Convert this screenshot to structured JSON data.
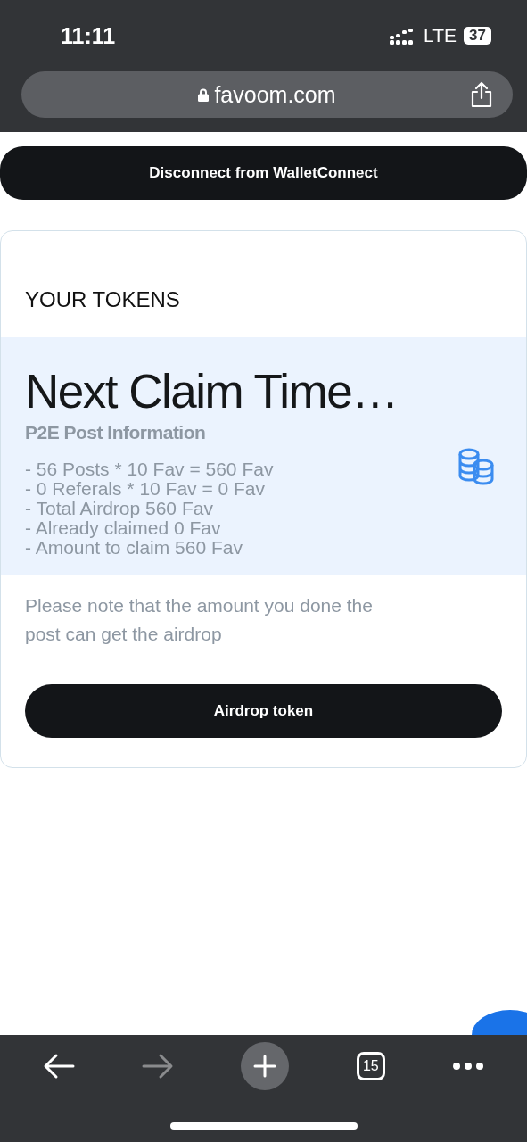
{
  "status_bar": {
    "time": "11:11",
    "network": "LTE",
    "battery": "37"
  },
  "address_bar": {
    "url": "favoom.com"
  },
  "disconnect_button": "Disconnect from WalletConnect",
  "card": {
    "title": "YOUR TOKENS",
    "heading": "Next Claim Time…",
    "subheading": "P2E Post Information",
    "lines": [
      "- 56 Posts * 10 Fav = 560 Fav",
      "- 0 Referals * 10 Fav = 0 Fav",
      "- Total Airdrop 560 Fav",
      "- Already claimed 0 Fav",
      "- Amount to claim 560 Fav"
    ],
    "note": "Please note that the amount you done the post can get the airdrop",
    "button": "Airdrop token"
  },
  "toolbar": {
    "back_disabled": false,
    "forward_disabled": true,
    "tabs_count": "15"
  }
}
